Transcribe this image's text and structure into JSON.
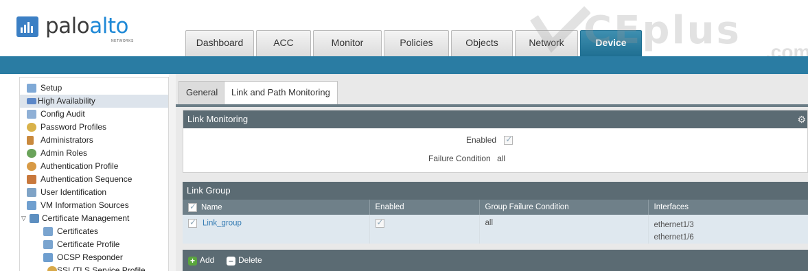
{
  "brand": {
    "logo_text_1": "palo",
    "logo_text_2": "alto",
    "logo_sub": "NETWORKS",
    "color_primary": "#1e88d6"
  },
  "tabs": [
    {
      "label": "Dashboard"
    },
    {
      "label": "ACC"
    },
    {
      "label": "Monitor"
    },
    {
      "label": "Policies"
    },
    {
      "label": "Objects"
    },
    {
      "label": "Network"
    },
    {
      "label": "Device",
      "active": true
    }
  ],
  "watermark": {
    "text": "CEplus",
    "suffix": ".com"
  },
  "sidebar": {
    "items": [
      {
        "label": "Setup",
        "icon": "setup-icon"
      },
      {
        "label": "High Availability",
        "icon": "high-availability-icon",
        "selected": true
      },
      {
        "label": "Config Audit",
        "icon": "config-audit-icon"
      },
      {
        "label": "Password Profiles",
        "icon": "password-profiles-icon"
      },
      {
        "label": "Administrators",
        "icon": "administrators-icon"
      },
      {
        "label": "Admin Roles",
        "icon": "admin-roles-icon"
      },
      {
        "label": "Authentication Profile",
        "icon": "authentication-profile-icon"
      },
      {
        "label": "Authentication Sequence",
        "icon": "authentication-sequence-icon"
      },
      {
        "label": "User Identification",
        "icon": "user-identification-icon"
      },
      {
        "label": "VM Information Sources",
        "icon": "vm-information-sources-icon"
      },
      {
        "label": "Certificate Management",
        "icon": "certificate-management-icon",
        "expanded": true
      },
      {
        "label": "Certificates",
        "icon": "certificates-icon",
        "child": true
      },
      {
        "label": "Certificate Profile",
        "icon": "certificate-profile-icon",
        "child": true
      },
      {
        "label": "OCSP Responder",
        "icon": "ocsp-responder-icon",
        "child": true
      },
      {
        "label": "SSL/TLS Service Profile",
        "icon": "ssl-tls-service-profile-icon",
        "child": true
      }
    ]
  },
  "subtabs": [
    {
      "label": "General"
    },
    {
      "label": "Link and Path Monitoring",
      "active": true
    }
  ],
  "link_monitoring": {
    "title": "Link Monitoring",
    "enabled_label": "Enabled",
    "enabled": true,
    "failure_label": "Failure Condition",
    "failure_value": "all"
  },
  "link_group": {
    "title": "Link Group",
    "columns": [
      "Name",
      "Enabled",
      "Group Failure Condition",
      "Interfaces"
    ],
    "rows": [
      {
        "checked": true,
        "name": "Link_group",
        "enabled": true,
        "group_failure": "all",
        "interfaces": [
          "ethernet1/3",
          "ethernet1/6"
        ]
      }
    ],
    "add_label": "Add",
    "delete_label": "Delete"
  }
}
